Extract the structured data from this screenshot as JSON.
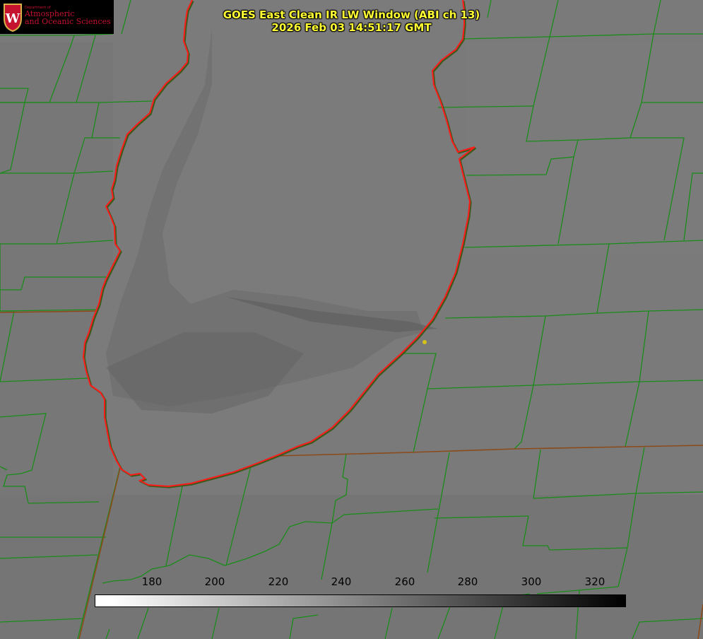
{
  "header": {
    "title_line1": "GOES East Clean IR LW Window (ABI ch 13)",
    "title_line2": "2026 Feb 03 14:51:17 GMT"
  },
  "logo": {
    "dept_small": "Department of",
    "line1": "Atmospheric",
    "line2": "and Oceanic Sciences",
    "emblem_letter": "W"
  },
  "colorbar": {
    "ticks": [
      "180",
      "200",
      "220",
      "240",
      "260",
      "280",
      "300",
      "320"
    ]
  },
  "colors": {
    "title_text": "#ffff33",
    "county_lines": "#1a8c1a",
    "state_border": "#8b4a1a",
    "shoreline": "#ff1a1a",
    "background_gray": "#7a7a7a",
    "lake_gray": "#7c7c7c",
    "point_marker": "#d4c21a"
  }
}
